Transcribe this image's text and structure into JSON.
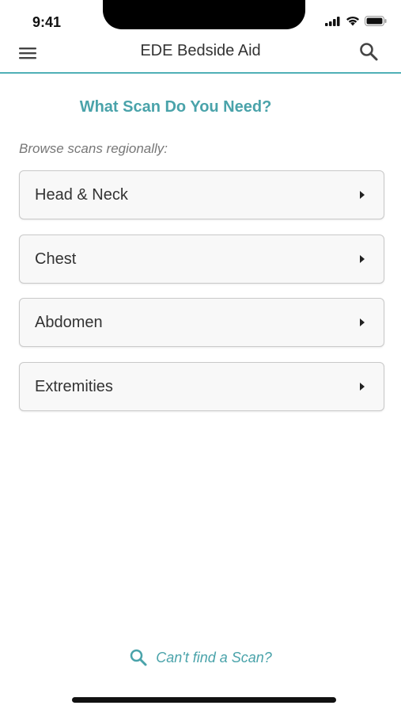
{
  "status_bar": {
    "time": "9:41"
  },
  "nav": {
    "title": "EDE Bedside Aid",
    "menu_icon": "hamburger-icon",
    "search_icon": "search-icon"
  },
  "main": {
    "heading": "What Scan Do You Need?",
    "subtitle": "Browse scans regionally:",
    "regions": [
      {
        "label": "Head & Neck"
      },
      {
        "label": "Chest"
      },
      {
        "label": "Abdomen"
      },
      {
        "label": "Extremities"
      }
    ]
  },
  "footer": {
    "cant_find_label": "Can't find a Scan?"
  },
  "colors": {
    "accent": "#4aa3aa",
    "nav_border": "#4fb0b6",
    "card_bg": "#f8f8f8",
    "card_border": "#c9c9c9"
  }
}
